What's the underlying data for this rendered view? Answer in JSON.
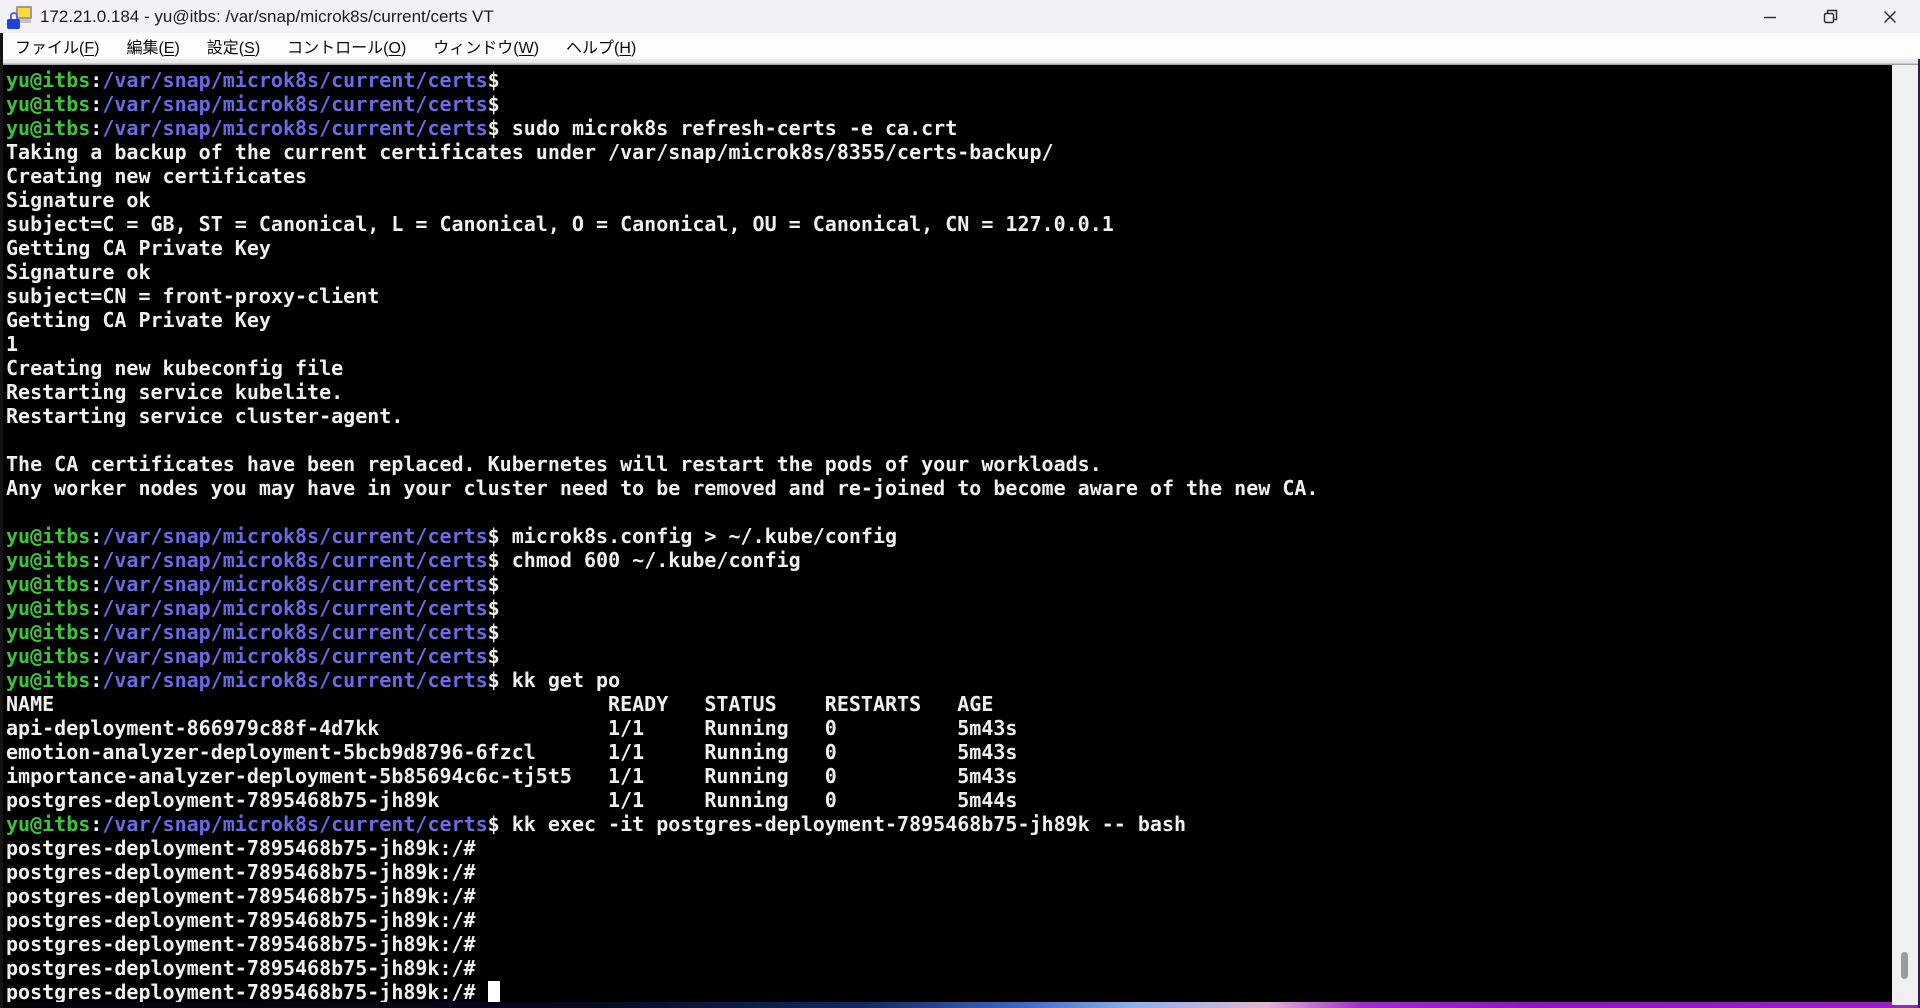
{
  "window": {
    "title": "172.21.0.184 - yu@itbs: /var/snap/microk8s/current/certs VT",
    "icon": "teraterm-ssh-padlock",
    "controls": {
      "minimize": "minimize",
      "restore": "restore",
      "close": "close"
    }
  },
  "menu": {
    "items": [
      {
        "pre": "ファイル(",
        "key": "F",
        "post": ")"
      },
      {
        "pre": "編集(",
        "key": "E",
        "post": ")"
      },
      {
        "pre": "設定(",
        "key": "S",
        "post": ")"
      },
      {
        "pre": "コントロール(",
        "key": "O",
        "post": ")"
      },
      {
        "pre": "ウィンドウ(",
        "key": "W",
        "post": ")"
      },
      {
        "pre": "ヘルプ(",
        "key": "H",
        "post": ")"
      }
    ]
  },
  "terminal": {
    "colors": {
      "bg": "#000000",
      "fg": "#f0f0f0",
      "green": "#3cc43c",
      "blue": "#6a6ae6"
    },
    "prompt": {
      "user": "yu@itbs",
      "sep": ":",
      "path": "/var/snap/microk8s/current/certs",
      "sigil": "$"
    },
    "pod_prompt": "postgres-deployment-7895468b75-jh89k:/#",
    "lines": [
      {
        "type": "prompt",
        "cmd": ""
      },
      {
        "type": "prompt",
        "cmd": ""
      },
      {
        "type": "prompt",
        "cmd": "sudo microk8s refresh-certs -e ca.crt"
      },
      {
        "type": "text",
        "text": "Taking a backup of the current certificates under /var/snap/microk8s/8355/certs-backup/"
      },
      {
        "type": "text",
        "text": "Creating new certificates"
      },
      {
        "type": "text",
        "text": "Signature ok"
      },
      {
        "type": "text",
        "text": "subject=C = GB, ST = Canonical, L = Canonical, O = Canonical, OU = Canonical, CN = 127.0.0.1"
      },
      {
        "type": "text",
        "text": "Getting CA Private Key"
      },
      {
        "type": "text",
        "text": "Signature ok"
      },
      {
        "type": "text",
        "text": "subject=CN = front-proxy-client"
      },
      {
        "type": "text",
        "text": "Getting CA Private Key"
      },
      {
        "type": "text",
        "text": "1"
      },
      {
        "type": "text",
        "text": "Creating new kubeconfig file"
      },
      {
        "type": "text",
        "text": "Restarting service kubelite."
      },
      {
        "type": "text",
        "text": "Restarting service cluster-agent."
      },
      {
        "type": "text",
        "text": ""
      },
      {
        "type": "text",
        "text": "The CA certificates have been replaced. Kubernetes will restart the pods of your workloads."
      },
      {
        "type": "text",
        "text": "Any worker nodes you may have in your cluster need to be removed and re-joined to become aware of the new CA."
      },
      {
        "type": "text",
        "text": ""
      },
      {
        "type": "prompt",
        "cmd": "microk8s.config > ~/.kube/config"
      },
      {
        "type": "prompt",
        "cmd": "chmod 600 ~/.kube/config"
      },
      {
        "type": "prompt",
        "cmd": ""
      },
      {
        "type": "prompt",
        "cmd": ""
      },
      {
        "type": "prompt",
        "cmd": ""
      },
      {
        "type": "prompt",
        "cmd": ""
      },
      {
        "type": "prompt",
        "cmd": "kk get po"
      },
      {
        "type": "text",
        "text": "NAME                                              READY   STATUS    RESTARTS   AGE"
      },
      {
        "type": "text",
        "text": "api-deployment-866979c88f-4d7kk                   1/1     Running   0          5m43s"
      },
      {
        "type": "text",
        "text": "emotion-analyzer-deployment-5bcb9d8796-6fzcl      1/1     Running   0          5m43s"
      },
      {
        "type": "text",
        "text": "importance-analyzer-deployment-5b85694c6c-tj5t5   1/1     Running   0          5m43s"
      },
      {
        "type": "text",
        "text": "postgres-deployment-7895468b75-jh89k              1/1     Running   0          5m44s"
      },
      {
        "type": "prompt",
        "cmd": "kk exec -it postgres-deployment-7895468b75-jh89k -- bash"
      },
      {
        "type": "pod-prompt"
      },
      {
        "type": "pod-prompt"
      },
      {
        "type": "pod-prompt"
      },
      {
        "type": "pod-prompt"
      },
      {
        "type": "pod-prompt"
      },
      {
        "type": "pod-prompt"
      },
      {
        "type": "pod-prompt",
        "cursor": true
      }
    ],
    "pod_table": {
      "headers": [
        "NAME",
        "READY",
        "STATUS",
        "RESTARTS",
        "AGE"
      ],
      "rows": [
        [
          "api-deployment-866979c88f-4d7kk",
          "1/1",
          "Running",
          "0",
          "5m43s"
        ],
        [
          "emotion-analyzer-deployment-5bcb9d8796-6fzcl",
          "1/1",
          "Running",
          "0",
          "5m43s"
        ],
        [
          "importance-analyzer-deployment-5b85694c6c-tj5t5",
          "1/1",
          "Running",
          "0",
          "5m43s"
        ],
        [
          "postgres-deployment-7895468b75-jh89k",
          "1/1",
          "Running",
          "0",
          "5m44s"
        ]
      ]
    }
  }
}
